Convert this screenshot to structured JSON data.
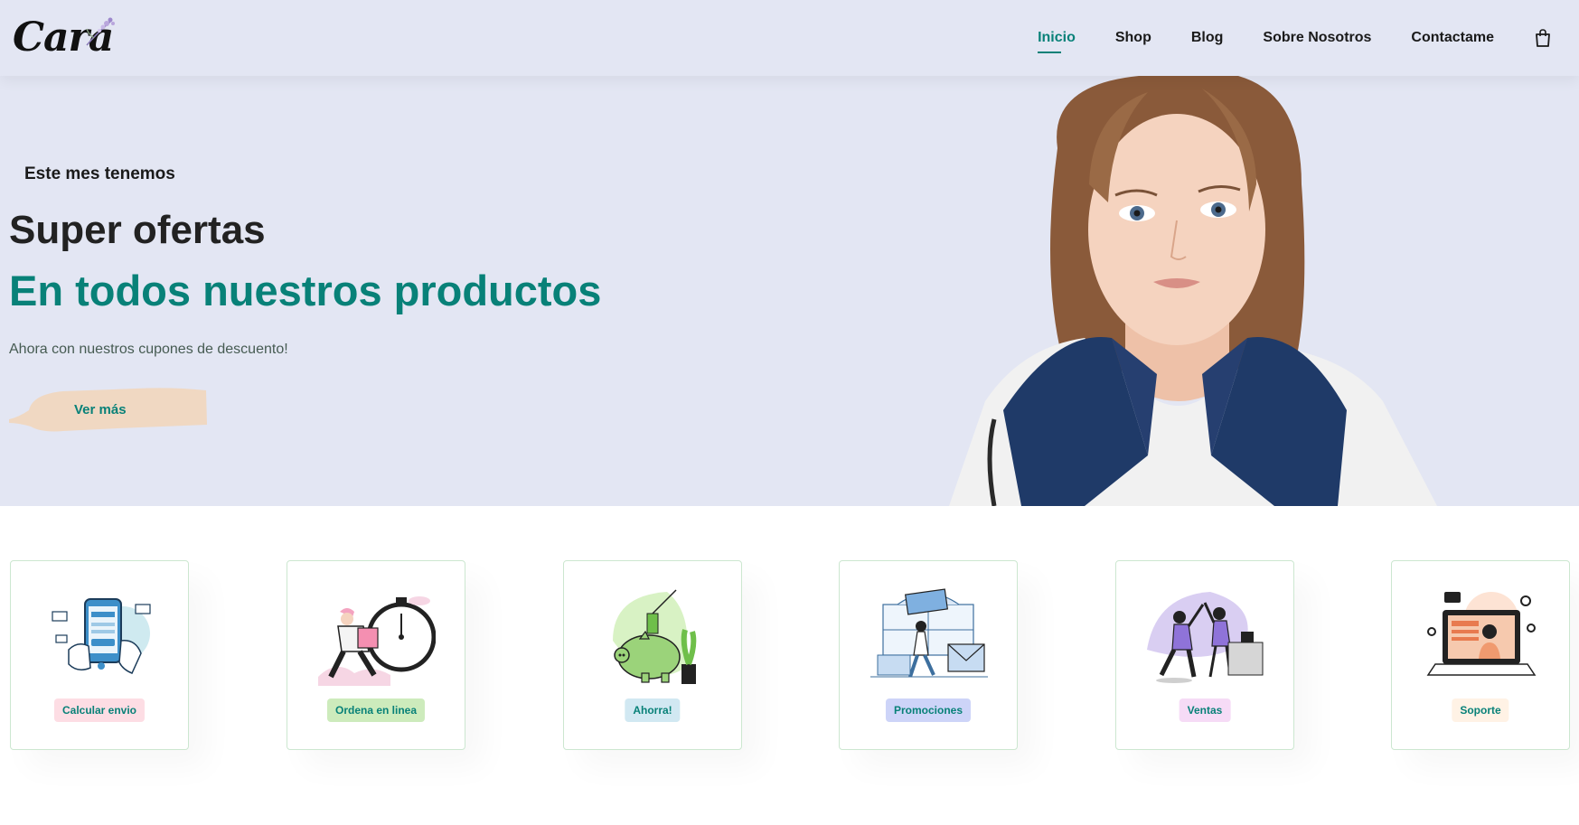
{
  "header": {
    "logo_text": "Cara",
    "nav": [
      {
        "label": "Inicio",
        "active": true
      },
      {
        "label": "Shop",
        "active": false
      },
      {
        "label": "Blog",
        "active": false
      },
      {
        "label": "Sobre Nosotros",
        "active": false
      },
      {
        "label": "Contactame",
        "active": false
      }
    ],
    "cart_icon": "shopping-bag-icon"
  },
  "hero": {
    "subtitle": "Este mes tenemos",
    "title": "Super ofertas",
    "title_highlight": "En todos nuestros productos",
    "text": "Ahora con nuestros cupones de descuento!",
    "button_label": "Ver más"
  },
  "features": [
    {
      "label": "Calcular envio",
      "icon": "mobile-payment-icon",
      "bg": "#fddde4"
    },
    {
      "label": "Ordena en linea",
      "icon": "delivery-clock-icon",
      "bg": "#cdebbc"
    },
    {
      "label": "Ahorra!",
      "icon": "piggy-bank-icon",
      "bg": "#d1e8f2"
    },
    {
      "label": "Promociones",
      "icon": "gift-mail-icon",
      "bg": "#cdd4f8"
    },
    {
      "label": "Ventas",
      "icon": "celebration-icon",
      "bg": "#f6dbf6"
    },
    {
      "label": "Soporte",
      "icon": "support-laptop-icon",
      "bg": "#fff2e5"
    }
  ],
  "colors": {
    "accent": "#088178",
    "hero_bg": "#e3e6f3",
    "button_brush": "#f0d8c2"
  }
}
